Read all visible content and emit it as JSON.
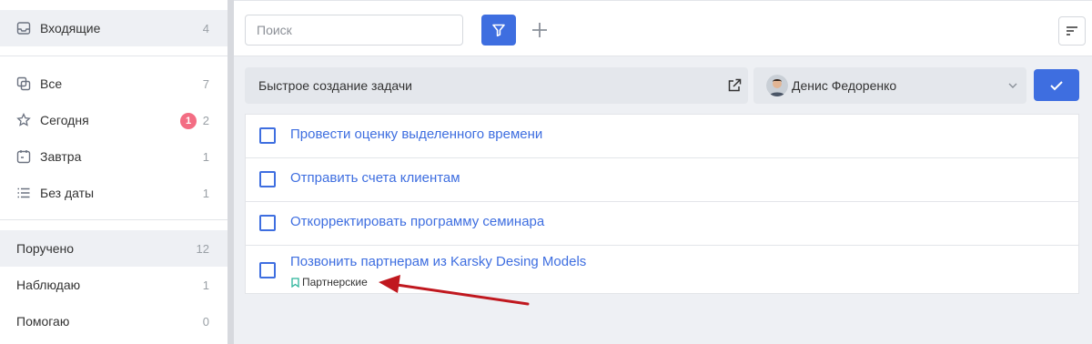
{
  "sidebar": {
    "inbox": {
      "label": "Входящие",
      "count": "4"
    },
    "smart": [
      {
        "label": "Все",
        "count": "7",
        "icon": "stack-icon"
      },
      {
        "label": "Сегодня",
        "count": "2",
        "badge": "1",
        "icon": "star-icon"
      },
      {
        "label": "Завтра",
        "count": "1",
        "icon": "calendar-icon"
      },
      {
        "label": "Без даты",
        "count": "1",
        "icon": "list-icon"
      }
    ],
    "roles": [
      {
        "label": "Поручено",
        "count": "12"
      },
      {
        "label": "Наблюдаю",
        "count": "1"
      },
      {
        "label": "Помогаю",
        "count": "0"
      }
    ]
  },
  "toolbar": {
    "search_placeholder": "Поиск"
  },
  "quick_create": {
    "placeholder": "Быстрое создание задачи",
    "assignee": "Денис Федоренко"
  },
  "tasks": [
    {
      "title": "Провести оценку выделенного времени"
    },
    {
      "title": "Отправить счета клиентам"
    },
    {
      "title": "Откорректировать программу семинара"
    },
    {
      "title": "Позвонить партнерам из Karsky Desing Models",
      "tag": "Партнерские"
    }
  ],
  "colors": {
    "accent": "#3e6ee0",
    "badge": "#f36d83",
    "annotation_arrow": "#c0181f",
    "tag_icon": "#2bb39a"
  }
}
